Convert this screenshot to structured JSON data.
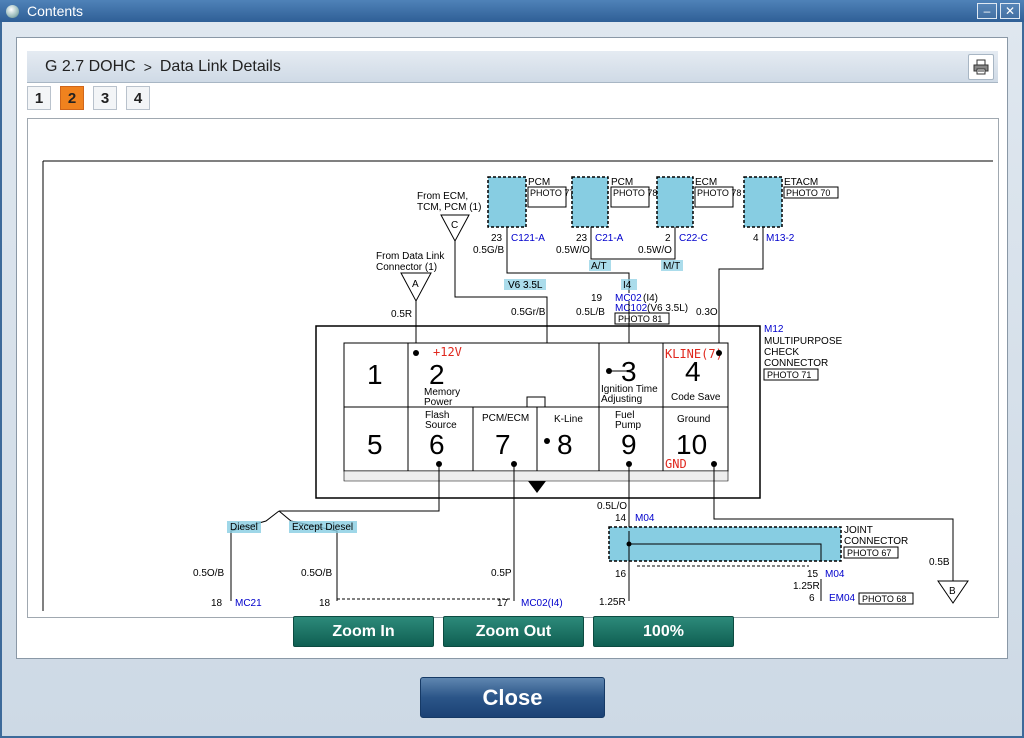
{
  "window": {
    "title": "Contents",
    "minimize": "–",
    "close": "✕"
  },
  "header": {
    "engine": "G 2.7 DOHC",
    "separator": ">",
    "section": "Data Link Details"
  },
  "page_tabs": [
    {
      "label": "1",
      "active": false
    },
    {
      "label": "2",
      "active": true
    },
    {
      "label": "3",
      "active": false
    },
    {
      "label": "4",
      "active": false
    }
  ],
  "diagram": {
    "top_connectors": [
      {
        "module": "PCM",
        "photo": "PHOTO 77",
        "pin": "23",
        "code": "C121-A",
        "wire": "0.5G/B"
      },
      {
        "module": "PCM",
        "photo": "PHOTO 78",
        "pin": "23",
        "code": "C21-A",
        "wire": "0.5W/O"
      },
      {
        "module": "ECM",
        "photo": "PHOTO 78",
        "pin": "2",
        "code": "C22-C",
        "wire": "0.5W/O"
      },
      {
        "module": "ETACM",
        "photo": "PHOTO 70",
        "pin": "4",
        "code": "M13-2",
        "wire": "0.3O"
      }
    ],
    "from_ecm": {
      "text1": "From ECM,",
      "text2": "TCM, PCM (1)",
      "letter": "C",
      "wire": "0.5Gr/B"
    },
    "from_dlc": {
      "text1": "From Data Link",
      "text2": "Connector (1)",
      "letter": "A",
      "wire": "0.5R"
    },
    "tags": {
      "v6": "V6 3.5L",
      "at": "A/T",
      "mt": "M/T",
      "i4": "I4"
    },
    "mc": {
      "pin": "19",
      "code1": "MC02",
      "suffix1": "(I4)",
      "code2": "MC102",
      "suffix2": "(V6 3.5L)",
      "photo": "PHOTO 81",
      "wire": "0.5L/B"
    },
    "m12": {
      "code": "M12",
      "line1": "MULTIPURPOSE",
      "line2": "CHECK",
      "line3": "CONNECTOR",
      "photo": "PHOTO 71"
    },
    "pins": [
      {
        "num": "1",
        "label1": "",
        "label2": ""
      },
      {
        "num": "2",
        "label1": "Memory",
        "label2": "Power"
      },
      {
        "num": "3",
        "label1": "Ignition Time",
        "label2": "Adjusting"
      },
      {
        "num": "4",
        "label1": "Code Save",
        "label2": ""
      },
      {
        "num": "5",
        "label1": "",
        "label2": ""
      },
      {
        "num": "6",
        "label1": "Flash",
        "label2": "Source"
      },
      {
        "num": "7",
        "label1": "PCM/ECM",
        "label2": ""
      },
      {
        "num": "8",
        "label1": "K-Line",
        "label2": ""
      },
      {
        "num": "9",
        "label1": "Fuel",
        "label2": "Pump"
      },
      {
        "num": "10",
        "label1": "Ground",
        "label2": ""
      }
    ],
    "annotations": {
      "v12": "+12V",
      "kline": "KLINE(7)",
      "gnd": "GND"
    },
    "lower": {
      "diesel": "Diesel",
      "except_diesel": "Except Diesel",
      "wire_05ob_a": "0.5O/B",
      "wire_05ob_b": "0.5O/B",
      "wire_05p": "0.5P",
      "wire_05lo": "0.5L/O",
      "pin14": "14",
      "m04_a": "M04",
      "joint1": "JOINT",
      "joint2": "CONNECTOR",
      "joint_photo": "PHOTO 67",
      "pin16": "16",
      "pin15": "15",
      "m04_b": "M04",
      "wire_125r_a": "1.25R",
      "wire_125r_b": "1.25R",
      "pin6": "6",
      "em04": "EM04",
      "em04_photo": "PHOTO 68",
      "wire_05b": "0.5B",
      "letter_b": "B",
      "pin18a": "18",
      "mc21": "MC21",
      "pin18b": "18",
      "pin17": "17",
      "mc02_low": "MC02(I4)"
    }
  },
  "zoom_buttons": {
    "zoom_in": "Zoom In",
    "zoom_out": "Zoom Out",
    "reset": "100%"
  },
  "close_label": "Close",
  "colors": {
    "connector_fill": "#87cde2",
    "annotation_red": "#e0281e",
    "code_blue": "#0000cc",
    "active_tab": "#f0821e"
  }
}
